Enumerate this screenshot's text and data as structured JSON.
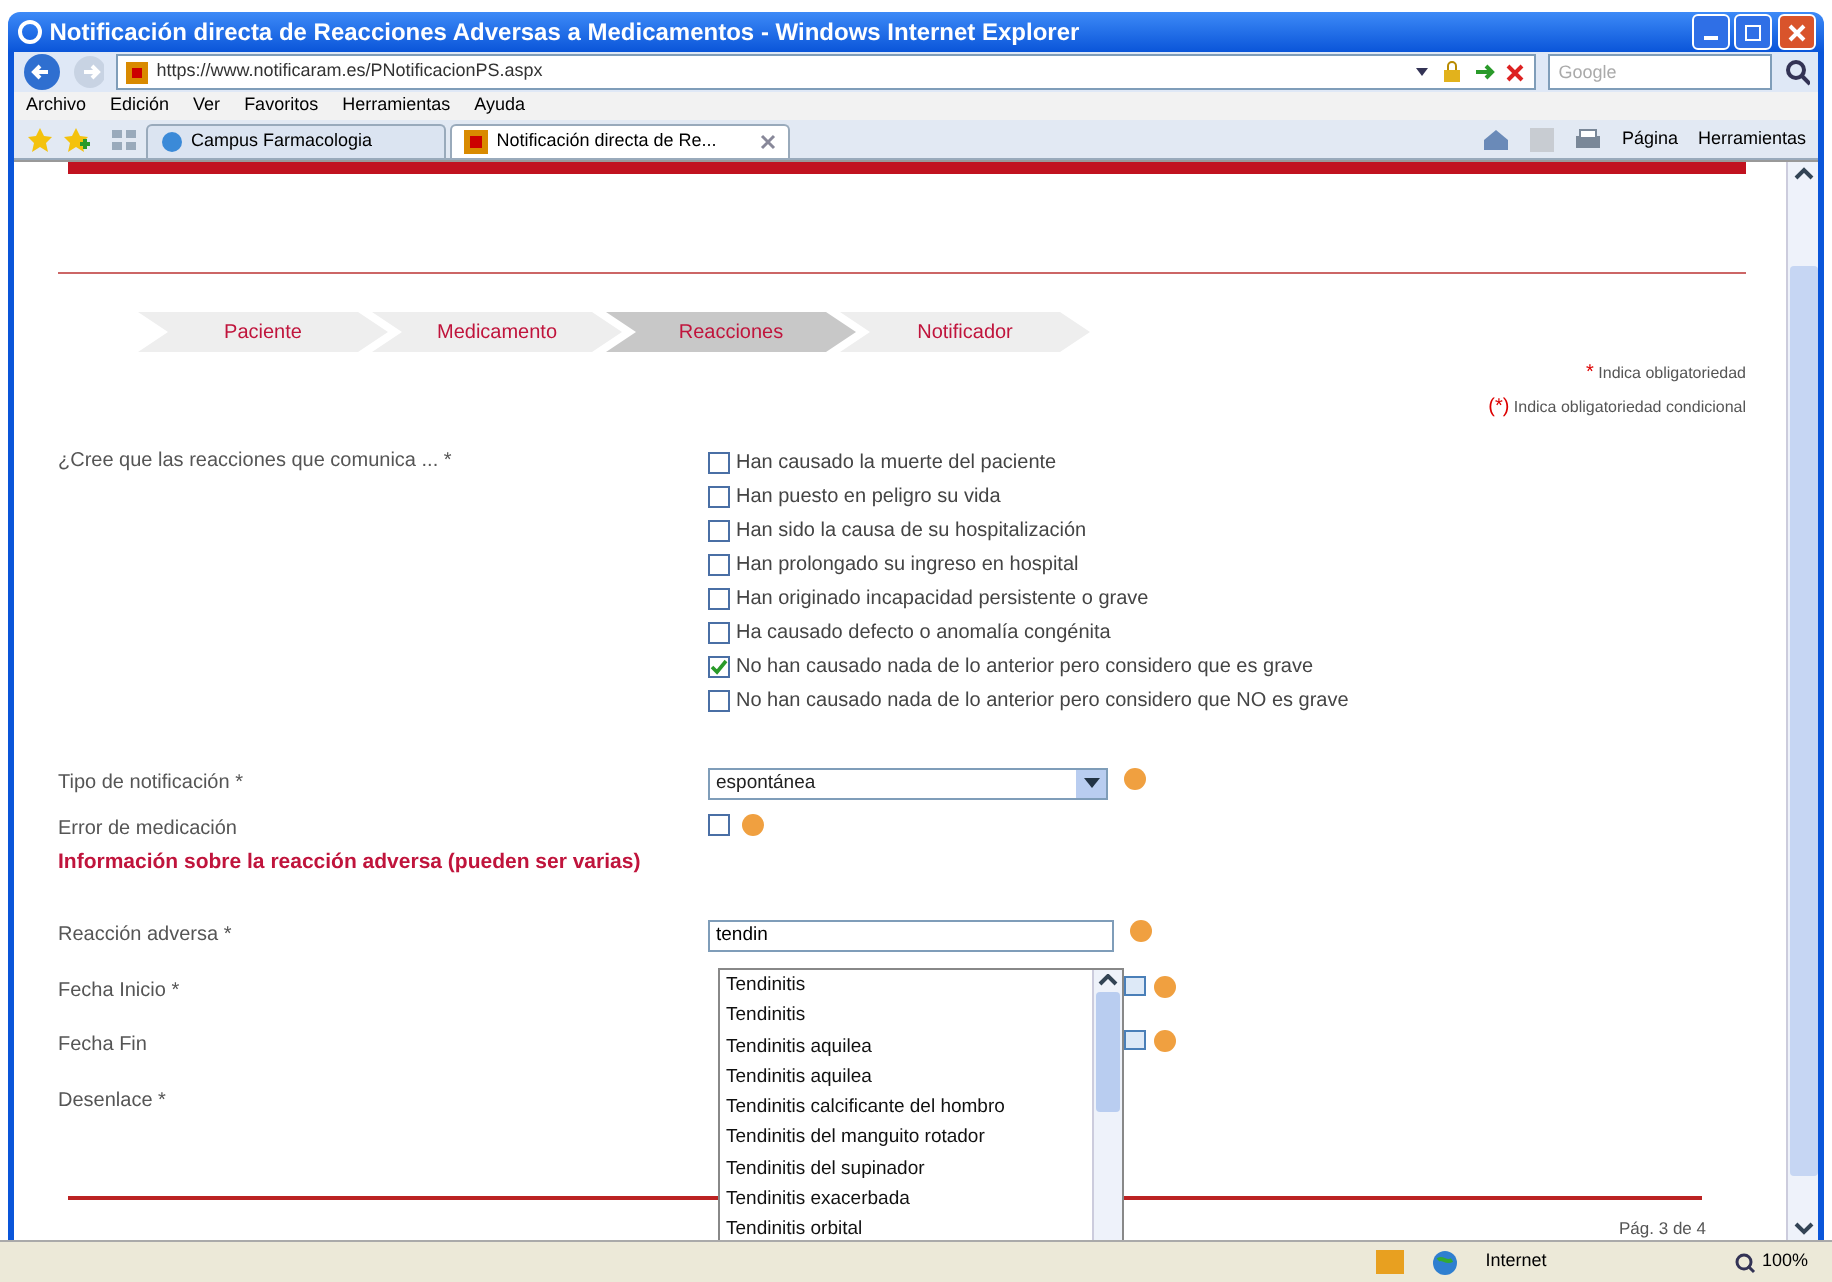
{
  "window": {
    "title": "Notificación directa de Reacciones Adversas a Medicamentos - Windows Internet Explorer"
  },
  "address_bar": {
    "url": "https://www.notificaram.es/PNotificacionPS.aspx",
    "search_placeholder": "Google"
  },
  "menu": [
    "Archivo",
    "Edición",
    "Ver",
    "Favoritos",
    "Herramientas",
    "Ayuda"
  ],
  "tabs": [
    {
      "label": "Campus Farmacologia",
      "selected": false
    },
    {
      "label": "Notificación directa de Re...",
      "selected": true
    }
  ],
  "command_bar": [
    "Página",
    "Herramientas"
  ],
  "steps": [
    {
      "label": "Paciente",
      "selected": false
    },
    {
      "label": "Medicamento",
      "selected": false
    },
    {
      "label": "Reacciones",
      "selected": true
    },
    {
      "label": "Notificador",
      "selected": false
    }
  ],
  "legend": [
    {
      "mark": "*",
      "text": "Indica obligatoriedad"
    },
    {
      "mark": "(*)",
      "text": "Indica obligatoriedad condicional"
    }
  ],
  "question": {
    "label": "¿Cree que las reacciones que comunica ... *",
    "options": [
      {
        "label": "Han causado la muerte del paciente",
        "checked": false
      },
      {
        "label": "Han puesto en peligro su vida",
        "checked": false
      },
      {
        "label": "Han sido la causa de su hospitalización",
        "checked": false
      },
      {
        "label": "Han prolongado su ingreso en hospital",
        "checked": false
      },
      {
        "label": "Han originado incapacidad persistente o grave",
        "checked": false
      },
      {
        "label": "Ha causado defecto o anomalía congénita",
        "checked": false
      },
      {
        "label": "No han causado nada de lo anterior pero considero que es grave",
        "checked": true
      },
      {
        "label": "No han causado nada de lo anterior pero considero que NO es grave",
        "checked": false
      }
    ]
  },
  "notification_type": {
    "label": "Tipo de notificación *",
    "value": "espontánea"
  },
  "medication_error": {
    "label": "Error de medicación",
    "checked": false
  },
  "section_heading": "Información sobre la reacción adversa (pueden ser varias)",
  "reaction": {
    "label": "Reacción adversa *",
    "value": "tendin"
  },
  "date_fields": [
    {
      "label": "Fecha Inicio *"
    },
    {
      "label": "Fecha Fin"
    }
  ],
  "outcome": {
    "label": "Desenlace *"
  },
  "suggestions": [
    "Tendinitis",
    "Tendinitis",
    "Tendinitis aquilea",
    "Tendinitis aquilea",
    "Tendinitis calcificante del hombro",
    "Tendinitis del manguito rotador",
    "Tendinitis del supinador",
    "Tendinitis exacerbada",
    "Tendinitis orbital"
  ],
  "page_number": "Pág. 3 de 4",
  "status_bar": {
    "zone": "Internet",
    "zoom": "100%"
  }
}
